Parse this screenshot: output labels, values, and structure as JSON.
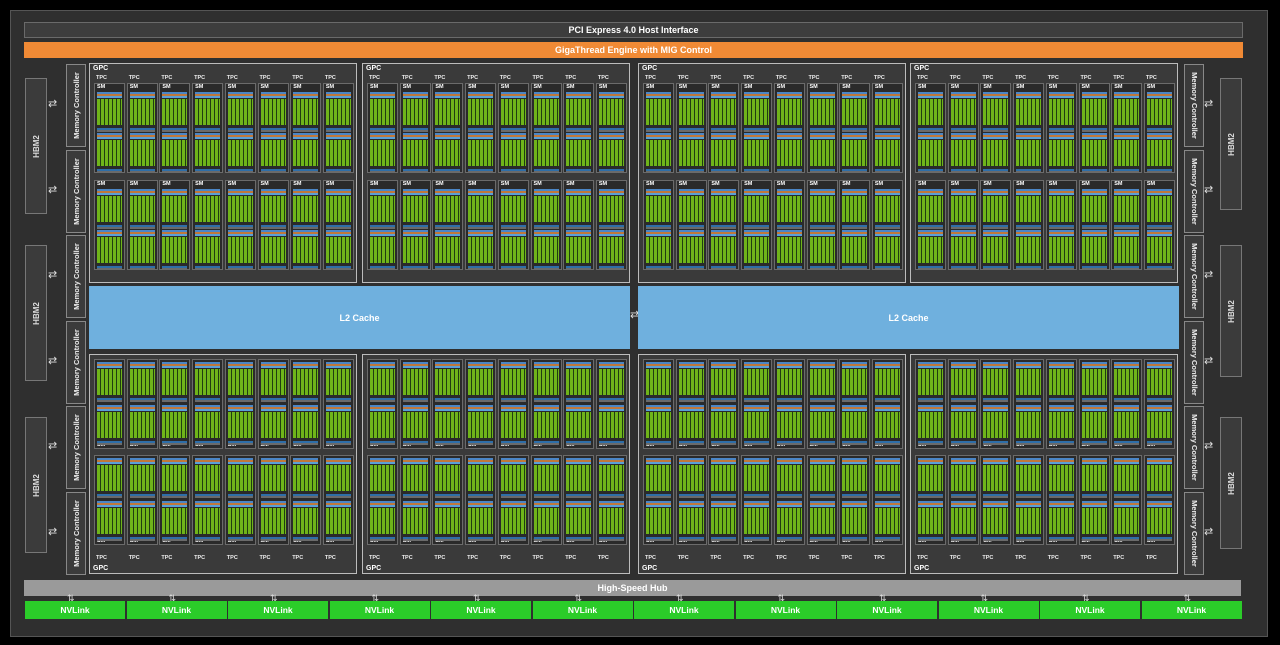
{
  "top_bars": {
    "pcie": "PCI Express 4.0 Host Interface",
    "gigathread": "GigaThread Engine with MIG Control"
  },
  "hub": "High-Speed Hub",
  "memory": {
    "hbm_label": "HBM2",
    "controller_label": "Memory Controller"
  },
  "l2": {
    "left": "L2 Cache",
    "right": "L2 Cache"
  },
  "gpc": {
    "label": "GPC",
    "tpc_label": "TPC",
    "sm_label": "SM"
  },
  "nvlink": [
    "NVLink",
    "NVLink",
    "NVLink",
    "NVLink",
    "NVLink",
    "NVLink",
    "NVLink",
    "NVLink",
    "NVLink",
    "NVLink",
    "NVLink",
    "NVLink"
  ],
  "colors": {
    "gigathread": "#f08a35",
    "l2": "#6fb0de",
    "nvlink": "#2bcc29",
    "hub": "#9a9a9a",
    "core": "#6fb41a"
  }
}
